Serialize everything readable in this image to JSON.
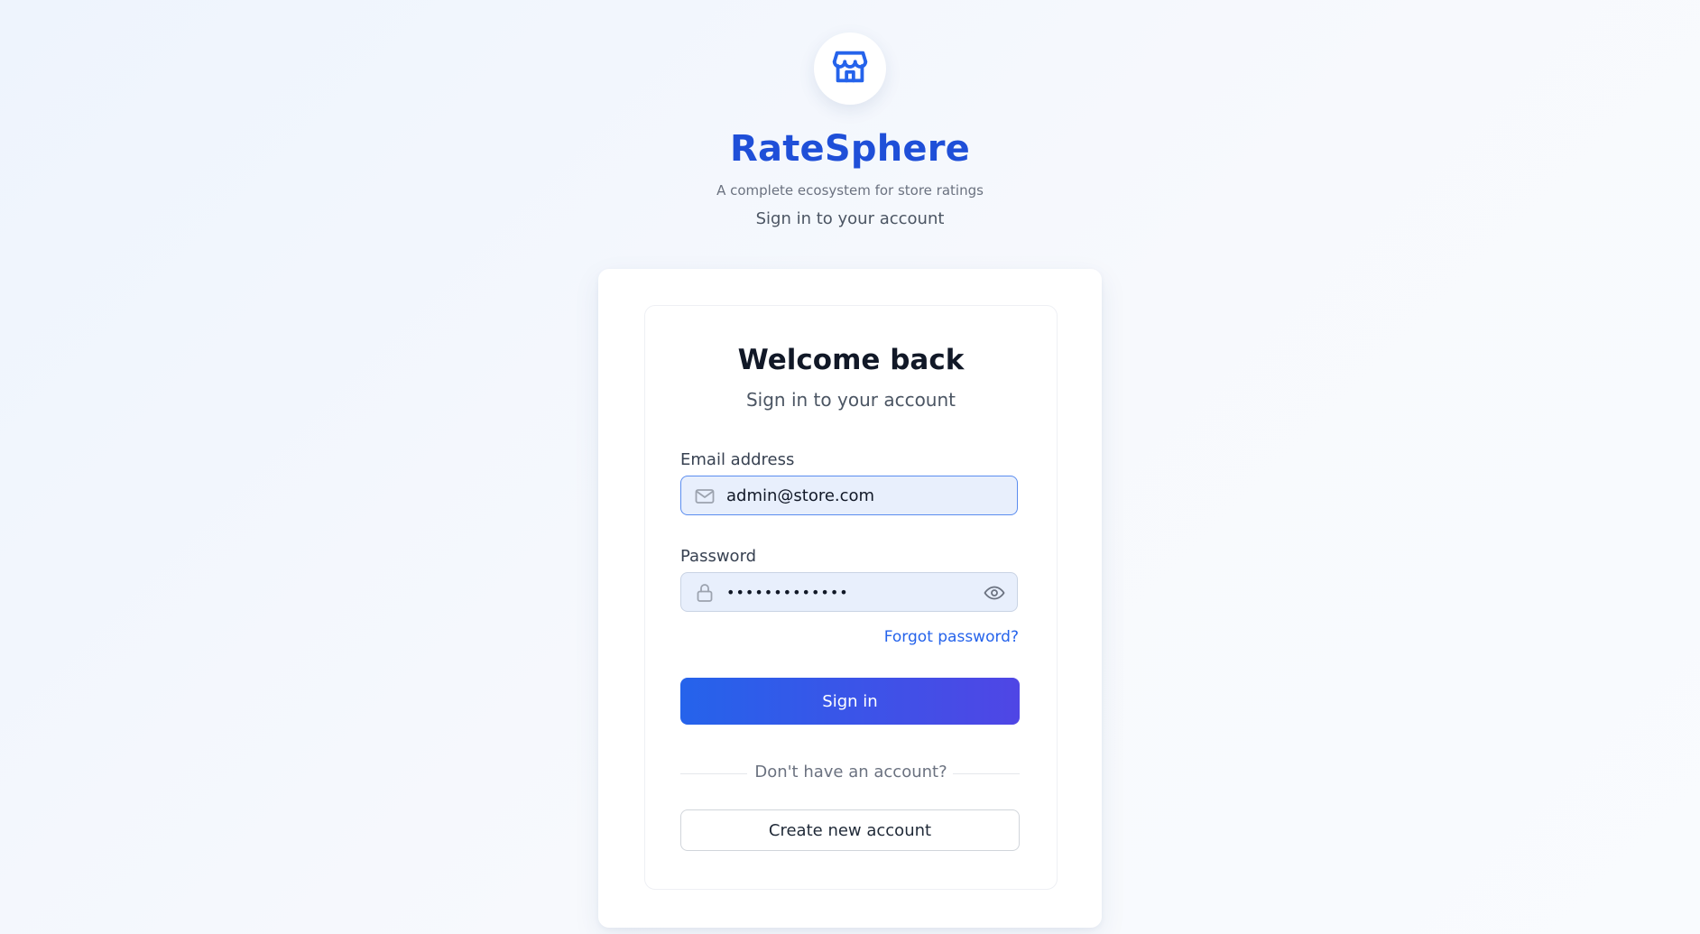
{
  "brand": {
    "logo_icon": "store-icon",
    "name": "RateSphere",
    "tagline": "A complete ecosystem for store ratings",
    "subheading": "Sign in to your account"
  },
  "login_card": {
    "title": "Welcome back",
    "subtitle": "Sign in to your account",
    "email": {
      "label": "Email address",
      "value": "admin@store.com",
      "icon": "mail-icon"
    },
    "password": {
      "label": "Password",
      "masked_value": "•••••••••••••",
      "icon": "lock-icon",
      "toggle_icon": "eye-icon"
    },
    "forgot_password": "Forgot password?",
    "signin_button": "Sign in",
    "divider_text": "Don't have an account?",
    "create_account_button": "Create new account"
  },
  "colors": {
    "brand": "#1f4fd8",
    "primary_gradient_start": "#2563eb",
    "primary_gradient_end": "#4f46e5",
    "link": "#2563eb",
    "input_background": "#e8effc"
  }
}
